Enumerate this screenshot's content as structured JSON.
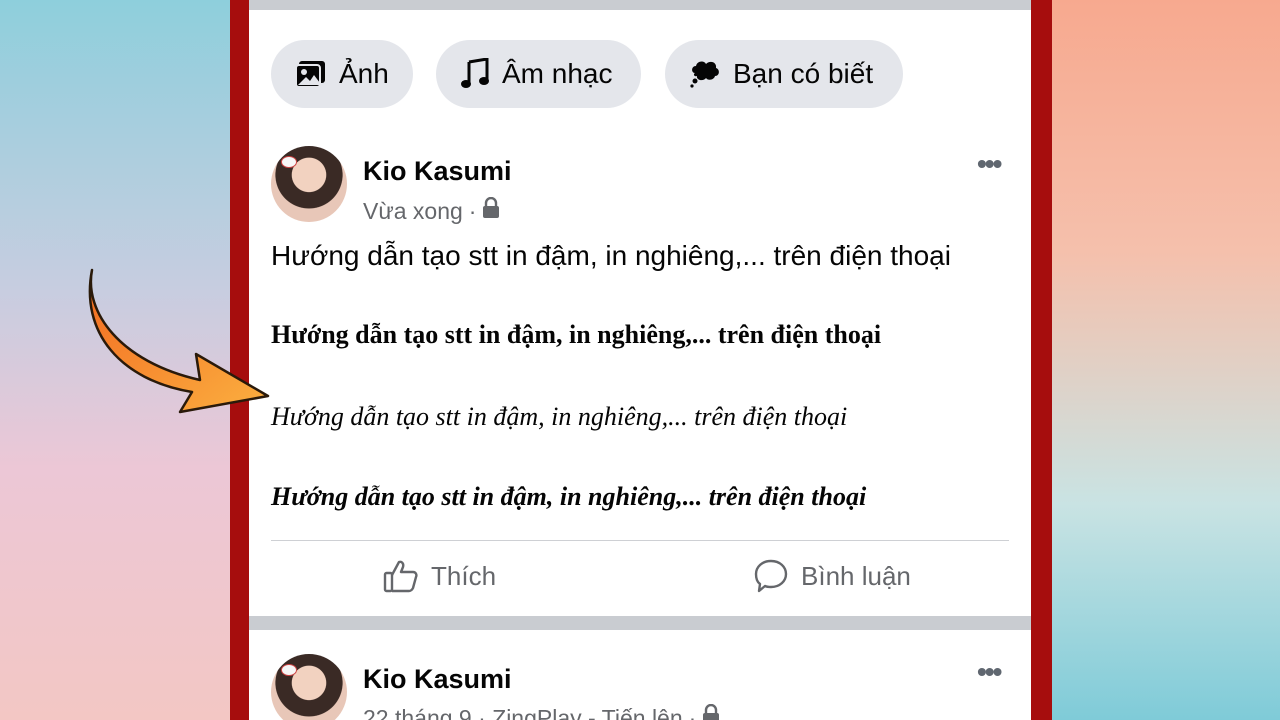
{
  "chips": {
    "photo": "Ảnh",
    "music": "Âm nhạc",
    "know": "Bạn có biết"
  },
  "post1": {
    "author": "Kio Kasumi",
    "time": "Vừa xong",
    "lines": [
      "Hướng dẫn tạo stt in đậm, in nghiêng,... trên điện thoại",
      "Hướng dẫn tạo stt in đậm, in nghiêng,... trên điện thoại",
      "Hướng dẫn tạo stt in đậm, in nghiêng,... trên điện thoại",
      "Hướng dẫn tạo stt in đậm, in nghiêng,... trên điện thoại"
    ],
    "like_label": "Thích",
    "comment_label": "Bình luận"
  },
  "post2": {
    "author": "Kio Kasumi",
    "meta": "22 tháng 9 · ZingPlay - Tiến lên"
  },
  "colors": {
    "frame": "#a60d0d",
    "arrow": "#f7931e"
  }
}
